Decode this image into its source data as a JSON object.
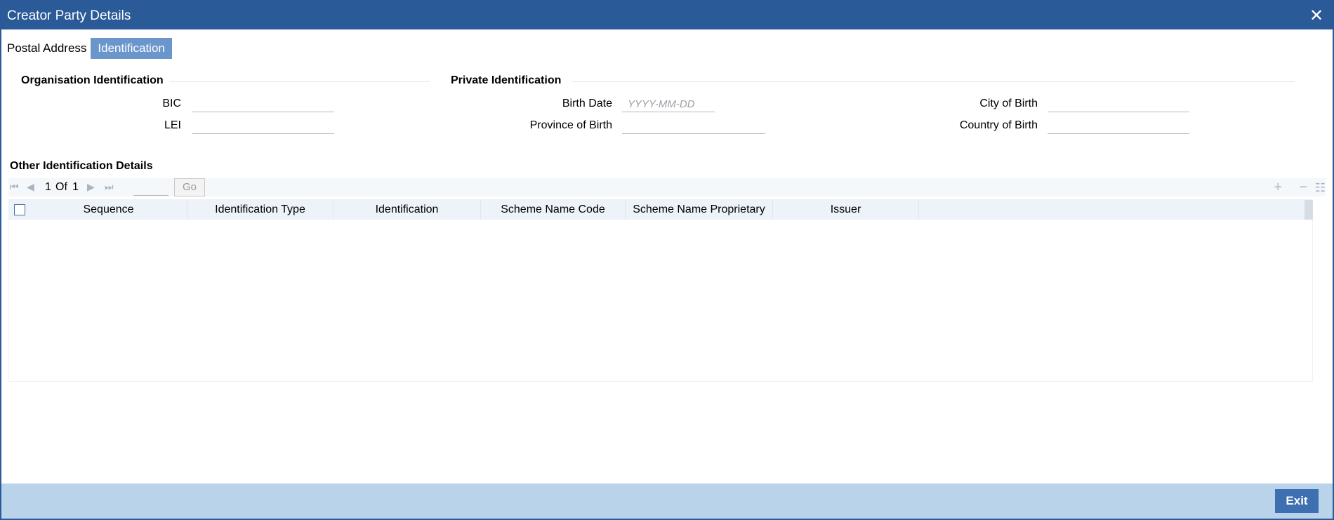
{
  "window": {
    "title": "Creator Party Details"
  },
  "tabs": [
    {
      "label": "Postal Address",
      "active": false
    },
    {
      "label": "Identification",
      "active": true
    }
  ],
  "organisation": {
    "heading": "Organisation Identification",
    "bic": {
      "label": "BIC",
      "value": ""
    },
    "lei": {
      "label": "LEI",
      "value": ""
    }
  },
  "private": {
    "heading": "Private Identification",
    "birth_date": {
      "label": "Birth Date",
      "value": "",
      "placeholder": "YYYY-MM-DD"
    },
    "province_of_birth": {
      "label": "Province of Birth",
      "value": ""
    },
    "city_of_birth": {
      "label": "City of Birth",
      "value": ""
    },
    "country_of_birth": {
      "label": "Country of Birth",
      "value": ""
    }
  },
  "other": {
    "heading": "Other Identification Details",
    "pager": {
      "current": "1",
      "of_label": "Of",
      "total": "1",
      "go_label": "Go"
    },
    "columns": [
      "Sequence",
      "Identification Type",
      "Identification",
      "Scheme Name Code",
      "Scheme Name Proprietary",
      "Issuer"
    ],
    "rows": []
  },
  "footer": {
    "exit_label": "Exit"
  },
  "colors": {
    "titlebar": "#2b5a98",
    "active_tab": "#6b96cc",
    "footer": "#b9d4ea",
    "button": "#3e6fb0"
  }
}
